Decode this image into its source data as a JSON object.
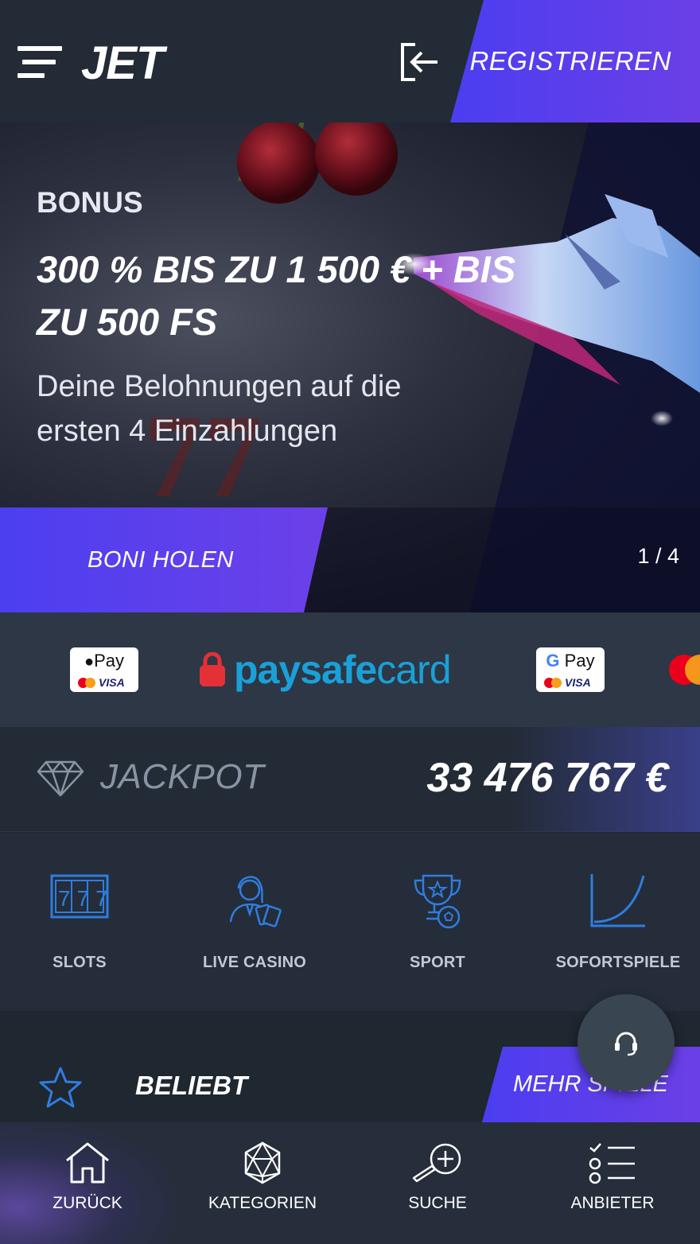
{
  "header": {
    "logo": "JET",
    "register_label": "REGISTRIEREN"
  },
  "hero": {
    "label": "BONUS",
    "title": "300 % BIS ZU 1 500 € + BIS ZU 500 FS",
    "subtitle": "Deine Belohnungen auf die ersten 4 Einzahlungen",
    "cta_label": "BONI HOLEN",
    "slide_counter": "1 / 4"
  },
  "payments": {
    "apple_pay": {
      "label": "Pay",
      "card": "VISA"
    },
    "paysafecard": {
      "bold": "paysafe",
      "light": "card"
    },
    "google_pay": {
      "label": "Pay",
      "card": "VISA"
    }
  },
  "jackpot": {
    "label": "JACKPOT",
    "value": "33 476 767 €"
  },
  "categories": [
    {
      "label": "SLOTS",
      "icon": "slot-machine-icon",
      "glyph": "777"
    },
    {
      "label": "LIVE CASINO",
      "icon": "live-dealer-icon"
    },
    {
      "label": "SPORT",
      "icon": "trophy-ball-icon"
    },
    {
      "label": "SOFORTSPIELE",
      "icon": "crash-curve-icon"
    }
  ],
  "popular": {
    "label": "BELIEBT",
    "more_label": "MEHR SPIELE"
  },
  "bottom_nav": [
    {
      "label": "ZURÜCK",
      "icon": "home-icon"
    },
    {
      "label": "KATEGORIEN",
      "icon": "dice-icon"
    },
    {
      "label": "SUCHE",
      "icon": "search-icon"
    },
    {
      "label": "ANBIETER",
      "icon": "provider-list-icon"
    }
  ],
  "colors": {
    "accent_start": "#4b3ef0",
    "accent_end": "#6b3fe6",
    "icon_blue": "#2f7de0",
    "background": "#1f2733",
    "paysafe_blue": "#1aa0d8"
  }
}
